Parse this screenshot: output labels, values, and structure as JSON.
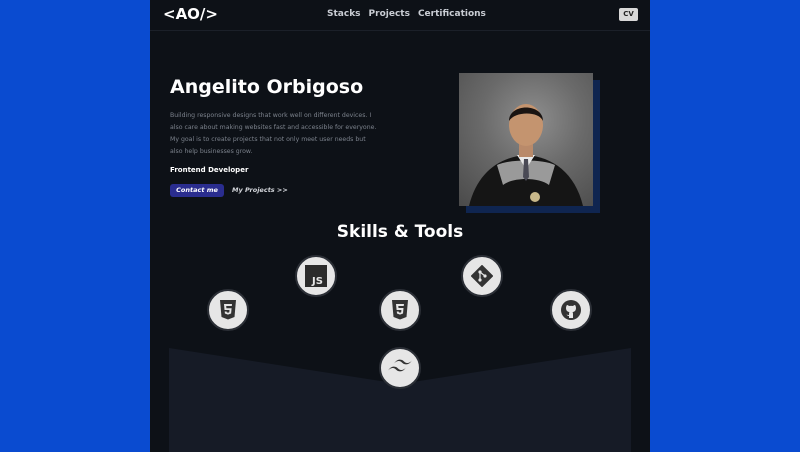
{
  "header": {
    "logo": "<AO/>",
    "nav": [
      "Stacks",
      "Projects",
      "Certifications"
    ],
    "cv_label": "CV"
  },
  "hero": {
    "name": "Angelito Orbigoso",
    "bio": "Building responsive designs that work well on different devices. I also care about making websites fast and accessible for everyone. My goal is to create projects that not only meet user needs but also help businesses grow.",
    "role": "Frontend Developer",
    "contact_label": "Contact me",
    "projects_label": "My Projects >>"
  },
  "skills": {
    "title": "Skills & Tools",
    "tools": [
      {
        "icon": "html5-icon"
      },
      {
        "icon": "javascript-icon"
      },
      {
        "icon": "css3-icon"
      },
      {
        "icon": "git-icon"
      },
      {
        "icon": "github-icon"
      },
      {
        "icon": "tailwind-icon"
      }
    ]
  },
  "colors": {
    "background": "#0a4bd0",
    "page": "#0d1117",
    "accent_button": "#2a2d8f",
    "text": "#ffffff"
  }
}
